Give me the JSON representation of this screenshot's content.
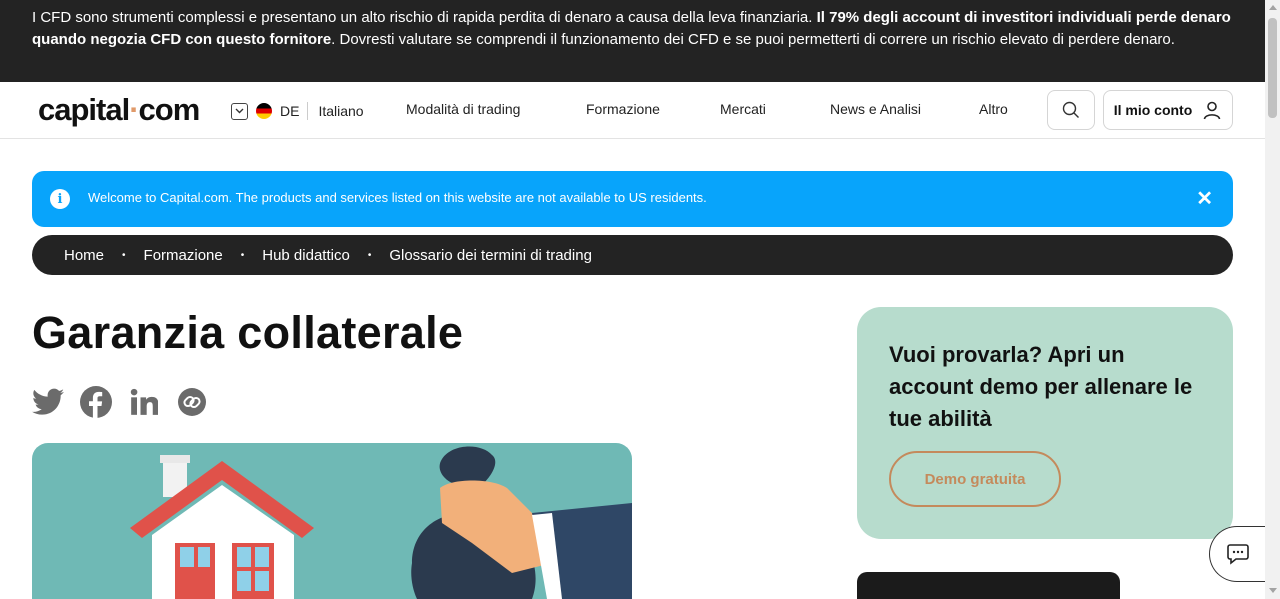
{
  "risk_warning": {
    "text_1": "I CFD sono strumenti complessi e presentano un alto rischio di rapida perdita di denaro a causa della leva finanziaria. ",
    "bold": "Il 79% degli account di investitori individuali perde denaro quando negozia CFD con questo fornitore",
    "text_2": ". Dovresti valutare se comprendi il funzionamento dei CFD e se puoi permetterti di correre un rischio elevato di perdere denaro."
  },
  "header": {
    "logo_left": "capital",
    "logo_dot": "·",
    "logo_right": "com",
    "region_code": "DE",
    "language": "Italiano",
    "nav": [
      "Modalità di trading",
      "Formazione",
      "Mercati",
      "News e Analisi",
      "Altro"
    ],
    "account_label": "Il mio conto"
  },
  "notice": {
    "info_glyph": "i",
    "text": "Welcome to Capital.com. The products and services listed on this website are not available to US residents.",
    "close_glyph": "✕"
  },
  "breadcrumb": {
    "items": [
      "Home",
      "Formazione",
      "Hub didattico",
      "Glossario dei termini di trading"
    ],
    "separator": "•"
  },
  "page_title": "Garanzia collaterale",
  "share_icons": [
    "twitter-icon",
    "facebook-icon",
    "linkedin-icon",
    "copy-link-icon"
  ],
  "demo_card": {
    "title": "Vuoi provarla? Apri un account demo per allenare le tue abilità",
    "button": "Demo gratuita"
  },
  "colors": {
    "banner_bg": "#232323",
    "notice_bg": "#08a4fb",
    "demo_card_bg": "#b7dccd",
    "demo_button": "#c48a5c",
    "hero_bg": "#6fb9b5"
  }
}
